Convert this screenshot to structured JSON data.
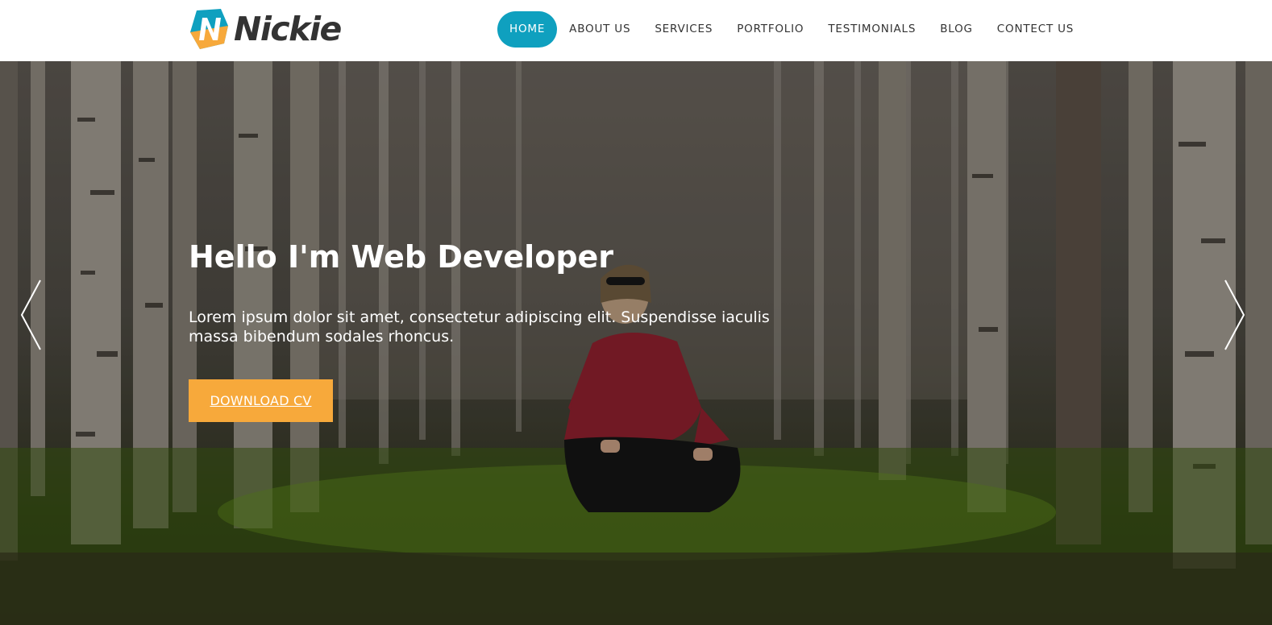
{
  "brand": {
    "name": "Nickie",
    "logo_letter": "N",
    "logo_colors": {
      "primary": "#0fa0bf",
      "secondary": "#f7a93b"
    }
  },
  "nav": {
    "items": [
      {
        "label": "HOME",
        "active": true
      },
      {
        "label": "ABOUT US",
        "active": false
      },
      {
        "label": "SERVICES",
        "active": false
      },
      {
        "label": "PORTFOLIO",
        "active": false
      },
      {
        "label": "TESTIMONIALS",
        "active": false
      },
      {
        "label": "BLOG",
        "active": false
      },
      {
        "label": "CONTECT US",
        "active": false
      }
    ]
  },
  "hero": {
    "title": "Hello I'm Web Developer",
    "text": "Lorem ipsum dolor sit amet, consectetur adipiscing elit. Suspendisse iaculis massa bibendum sodales rhoncus.",
    "cta_label": "DOWNLOAD CV",
    "cta_color": "#f7a93b",
    "prev_icon": "chevron-left-icon",
    "next_icon": "chevron-right-icon"
  }
}
